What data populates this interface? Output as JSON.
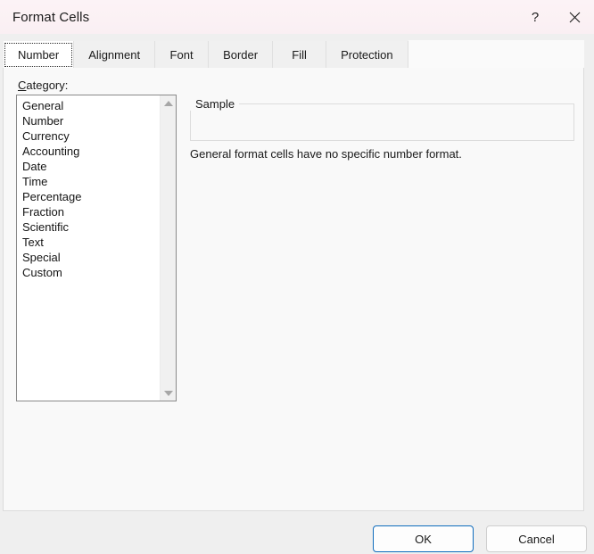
{
  "window": {
    "title": "Format Cells",
    "help_icon": "question-mark-icon",
    "help_glyph": "?",
    "close_icon": "close-icon",
    "accent_color": "#0f6cbd",
    "titlebar_color": "#fbf1f4"
  },
  "tabs": [
    {
      "label": "Number",
      "active": true
    },
    {
      "label": "Alignment",
      "active": false
    },
    {
      "label": "Font",
      "active": false
    },
    {
      "label": "Border",
      "active": false
    },
    {
      "label": "Fill",
      "active": false
    },
    {
      "label": "Protection",
      "active": false
    }
  ],
  "number_tab": {
    "category_label_prefix": "C",
    "category_label_rest": "ategory:",
    "categories": [
      "General",
      "Number",
      "Currency",
      "Accounting",
      "Date",
      "Time",
      "Percentage",
      "Fraction",
      "Scientific",
      "Text",
      "Special",
      "Custom"
    ],
    "selected_category": "General",
    "sample": {
      "legend": "Sample",
      "value": ""
    },
    "description": "General format cells have no specific number format."
  },
  "footer": {
    "ok_label": "OK",
    "cancel_label": "Cancel"
  }
}
